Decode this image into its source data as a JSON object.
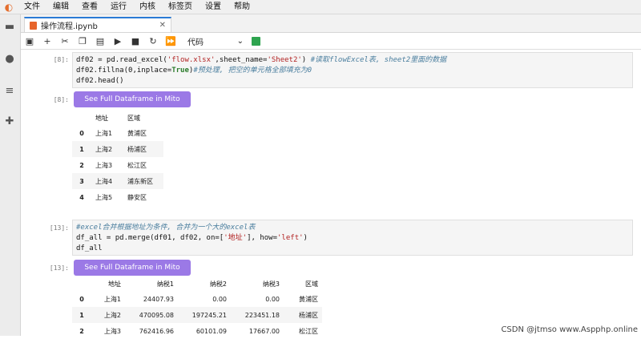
{
  "menubar": {
    "items": [
      "文件",
      "编辑",
      "查看",
      "运行",
      "内核",
      "标签页",
      "设置",
      "帮助"
    ]
  },
  "tab": {
    "title": "操作流程.ipynb"
  },
  "toolbar": {
    "cell_type": "代码"
  },
  "cells": [
    {
      "in_prompt": "[8]:",
      "out_prompt": "[8]:",
      "code": [
        "df02 = pd.read_excel('flow.xlsx',sheet_name='Sheet2') #读取flowExcel表, sheet2里面的数据",
        "df02.fillna(0,inplace=True)#预处理, 把空的单元格全部填充为0",
        "df02.head()"
      ],
      "mito_label": "See Full Dataframe in Mito",
      "table": {
        "columns": [
          "",
          "地址",
          "区域"
        ],
        "rows": [
          [
            "0",
            "上海1",
            "黄浦区"
          ],
          [
            "1",
            "上海2",
            "杨浦区"
          ],
          [
            "2",
            "上海3",
            "松江区"
          ],
          [
            "3",
            "上海4",
            "浦东新区"
          ],
          [
            "4",
            "上海5",
            "静安区"
          ]
        ]
      }
    },
    {
      "in_prompt": "[13]:",
      "out_prompt": "[13]:",
      "code": [
        "#excel合并根据地址为条件, 合并为一个大的excel表",
        "df_all = pd.merge(df01, df02, on=['地址'], how='left')",
        "df_all"
      ],
      "mito_label": "See Full Dataframe in Mito",
      "table": {
        "columns": [
          "",
          "地址",
          "纳税1",
          "纳税2",
          "纳税3",
          "区域"
        ],
        "rows": [
          [
            "0",
            "上海1",
            "24407.93",
            "0.00",
            "0.00",
            "黄浦区"
          ],
          [
            "1",
            "上海2",
            "470095.08",
            "197245.21",
            "223451.18",
            "杨浦区"
          ],
          [
            "2",
            "上海3",
            "762416.96",
            "60101.09",
            "17667.00",
            "松江区"
          ]
        ]
      }
    }
  ],
  "watermark": "CSDN @jtmso www.Aspphp.online"
}
